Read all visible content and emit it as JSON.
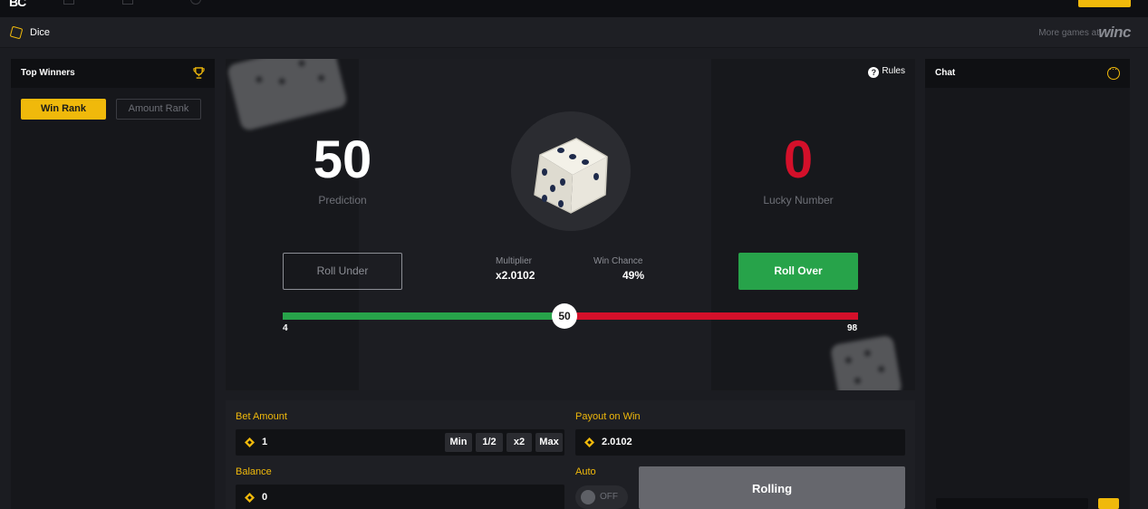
{
  "titlebar": {
    "title": "Dice",
    "more_games": "More games at",
    "brand_logo": "winc"
  },
  "left_panel": {
    "title": "Top Winners",
    "icon": "trophy-icon",
    "tabs": [
      {
        "label": "Win Rank",
        "active": true
      },
      {
        "label": "Amount Rank",
        "active": false
      }
    ]
  },
  "chat_panel": {
    "title": "Chat",
    "icon": "chat-bubble-icon"
  },
  "game": {
    "rules_label": "Rules",
    "prediction": {
      "value": "50",
      "label": "Prediction"
    },
    "lucky_number": {
      "value": "0",
      "label": "Lucky Number"
    },
    "roll_under_label": "Roll Under",
    "roll_over_label": "Roll Over",
    "multiplier": {
      "label": "Multiplier",
      "value": "x2.0102"
    },
    "win_chance": {
      "label": "Win Chance",
      "value": "49%"
    },
    "slider": {
      "value": "50",
      "min_label": "4",
      "max_label": "98"
    }
  },
  "bet_panel": {
    "bet_amount": {
      "label": "Bet Amount",
      "value": "1",
      "buttons": [
        "Min",
        "1/2",
        "x2",
        "Max"
      ]
    },
    "payout": {
      "label": "Payout on Win",
      "value": "2.0102"
    },
    "balance": {
      "label": "Balance",
      "value": "0"
    },
    "auto": {
      "label": "Auto",
      "state": "OFF"
    },
    "action_label": "Rolling"
  },
  "colors": {
    "accent": "#f0b90b",
    "win_green": "#27a34a",
    "loss_red": "#d4102a"
  }
}
